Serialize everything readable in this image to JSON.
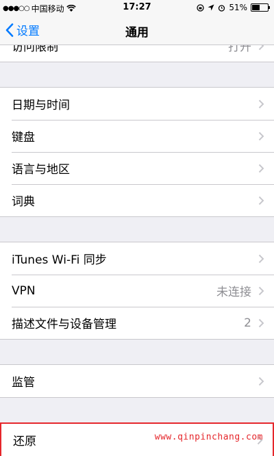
{
  "status_bar": {
    "signal": "●●●○○",
    "carrier": "中国移动",
    "time": "17:27",
    "battery_percent": "51%",
    "battery_level": 0.51
  },
  "nav": {
    "back_label": "设置",
    "title": "通用"
  },
  "partial_row": {
    "label": "访问限制",
    "detail": "打开"
  },
  "groups": [
    {
      "rows": [
        {
          "label": "日期与时间"
        },
        {
          "label": "键盘"
        },
        {
          "label": "语言与地区"
        },
        {
          "label": "词典"
        }
      ]
    },
    {
      "rows": [
        {
          "label": "iTunes Wi-Fi 同步"
        },
        {
          "label": "VPN",
          "detail": "未连接"
        },
        {
          "label": "描述文件与设备管理",
          "detail": "2"
        }
      ]
    },
    {
      "rows": [
        {
          "label": "监管"
        }
      ]
    }
  ],
  "reset_row": {
    "label": "还原"
  },
  "watermark": "www.qinpinchang.com",
  "colors": {
    "accent": "#007aff",
    "highlight": "#e5262b",
    "background": "#efeff4"
  }
}
